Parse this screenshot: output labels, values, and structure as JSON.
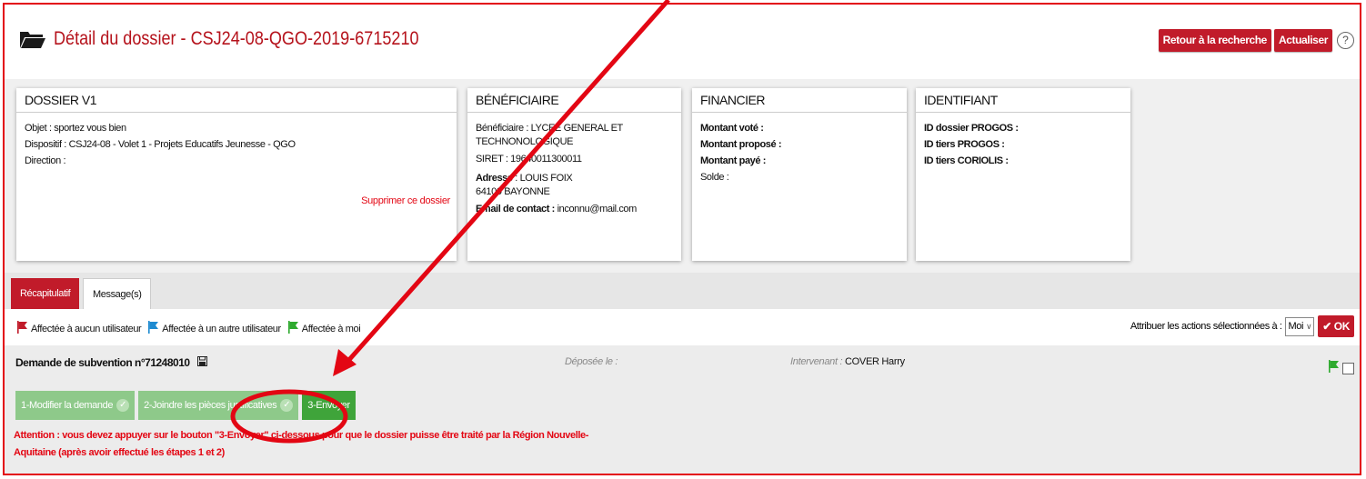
{
  "header": {
    "title": "Détail du dossier - CSJ24-08-QGO-2019-6715210",
    "back_button": "Retour à la recherche",
    "refresh_button": "Actualiser",
    "help_symbol": "?"
  },
  "cards": {
    "dossier": {
      "heading": "DOSSIER V1",
      "objet_label": "Objet :",
      "objet_value": " sportez vous bien",
      "dispositif_label": "Dispositif :",
      "dispositif_value": " CSJ24-08 - Volet 1 - Projets Educatifs Jeunesse - QGO",
      "direction_label": "Direction :",
      "delete_link": "Supprimer ce dossier"
    },
    "beneficiaire": {
      "heading": "BÉNÉFICIAIRE",
      "benef_label": "Bénéficiaire :",
      "benef_value": " LYCEE GENERAL ET TECHNONOLOGIQUE",
      "siret_label": "SIRET :",
      "siret_value": " 19640011300011",
      "adresse_label": "Adresse",
      "adresse_line1": " : LOUIS FOIX",
      "adresse_line2": "64100 BAYONNE",
      "email_label": "Email de contact :",
      "email_value": " inconnu@mail.com"
    },
    "financier": {
      "heading": "FINANCIER",
      "vote": "Montant voté :",
      "propose": "Montant proposé :",
      "paye": "Montant payé :",
      "solde": "Solde :"
    },
    "identifiant": {
      "heading": "IDENTIFIANT",
      "id_dossier": "ID dossier PROGOS :",
      "id_tiers": "ID tiers PROGOS :",
      "id_coriolis": "ID tiers CORIOLIS :"
    }
  },
  "tabs": {
    "recap": "Récapitulatif",
    "messages": "Message(s)"
  },
  "legend": {
    "red": "Affectée à aucun utilisateur",
    "blue": "Affectée à un autre utilisateur",
    "green": "Affectée à moi"
  },
  "assign": {
    "label": "Attribuer les actions sélectionnées à :",
    "selected": "Moi",
    "ok": "OK"
  },
  "request": {
    "title": "Demande de subvention n°71248010",
    "deposee": "Déposée le :",
    "intervenant_label": "Intervenant :",
    "intervenant_value": " COVER Harry",
    "step1": "1-Modifier la demande",
    "step2": "2-Joindre les pièces justificatives",
    "step3": "3-Envoyer",
    "warning": "Attention : vous devez appuyer sur le bouton \"3-Envoyer\" ci-dessous pour que le dossier puisse être traité par la Région Nouvelle-Aquitaine (après avoir effectué les étapes 1 et 2)"
  },
  "colors": {
    "brand_red": "#c11b2a",
    "annotation_red": "#e30613",
    "step_green": "#3fa43a"
  }
}
